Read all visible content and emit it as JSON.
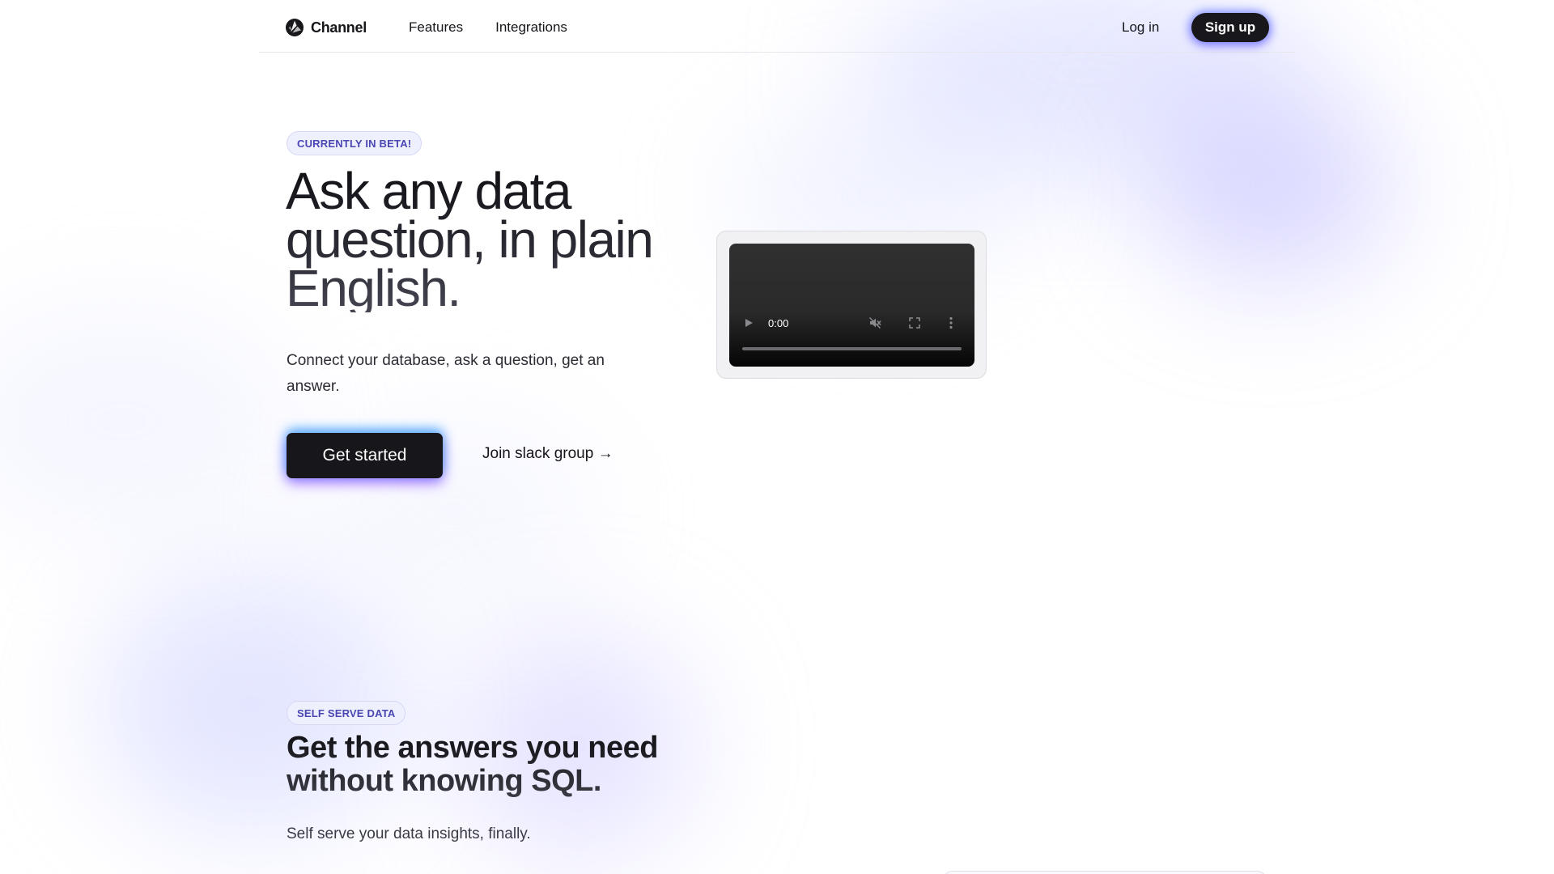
{
  "header": {
    "brand": {
      "name": "Channel",
      "logo_icon": "channel-logo-icon"
    },
    "nav": [
      {
        "label": "Features"
      },
      {
        "label": "Integrations"
      }
    ],
    "login_label": "Log in",
    "signup_label": "Sign up"
  },
  "hero": {
    "badge": "CURRENTLY IN BETA!",
    "title": "Ask any data question, in plain English.",
    "subtitle": "Connect your database, ask a question, get an answer.",
    "primary_cta": "Get started",
    "secondary_cta": "Join slack group →"
  },
  "video": {
    "time": "0:00",
    "controls": [
      "play-icon",
      "mute-icon",
      "fullscreen-icon",
      "more-options-icon"
    ],
    "progress": 0
  },
  "section": {
    "badge": "SELF SERVE DATA",
    "title": "Get the answers you need without knowing SQL.",
    "subtitle": "Self serve your data insights, finally."
  },
  "colors": {
    "primary_button": "#16161b",
    "badge_text": "#4a46b4",
    "badge_bg": "#eef0fd",
    "glow_blue": "#1e96ff",
    "glow_purple": "#823cff"
  }
}
